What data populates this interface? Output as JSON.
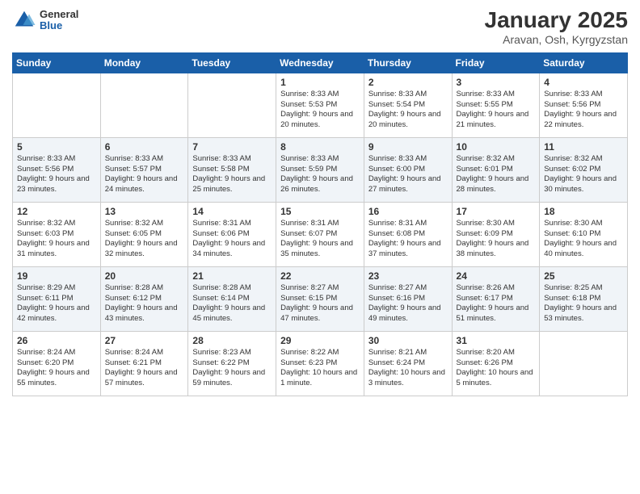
{
  "header": {
    "logo_general": "General",
    "logo_blue": "Blue",
    "month_title": "January 2025",
    "location": "Aravan, Osh, Kyrgyzstan"
  },
  "weekdays": [
    "Sunday",
    "Monday",
    "Tuesday",
    "Wednesday",
    "Thursday",
    "Friday",
    "Saturday"
  ],
  "weeks": [
    [
      {
        "day": "",
        "sunrise": "",
        "sunset": "",
        "daylight": ""
      },
      {
        "day": "",
        "sunrise": "",
        "sunset": "",
        "daylight": ""
      },
      {
        "day": "",
        "sunrise": "",
        "sunset": "",
        "daylight": ""
      },
      {
        "day": "1",
        "sunrise": "Sunrise: 8:33 AM",
        "sunset": "Sunset: 5:53 PM",
        "daylight": "Daylight: 9 hours and 20 minutes."
      },
      {
        "day": "2",
        "sunrise": "Sunrise: 8:33 AM",
        "sunset": "Sunset: 5:54 PM",
        "daylight": "Daylight: 9 hours and 20 minutes."
      },
      {
        "day": "3",
        "sunrise": "Sunrise: 8:33 AM",
        "sunset": "Sunset: 5:55 PM",
        "daylight": "Daylight: 9 hours and 21 minutes."
      },
      {
        "day": "4",
        "sunrise": "Sunrise: 8:33 AM",
        "sunset": "Sunset: 5:56 PM",
        "daylight": "Daylight: 9 hours and 22 minutes."
      }
    ],
    [
      {
        "day": "5",
        "sunrise": "Sunrise: 8:33 AM",
        "sunset": "Sunset: 5:56 PM",
        "daylight": "Daylight: 9 hours and 23 minutes."
      },
      {
        "day": "6",
        "sunrise": "Sunrise: 8:33 AM",
        "sunset": "Sunset: 5:57 PM",
        "daylight": "Daylight: 9 hours and 24 minutes."
      },
      {
        "day": "7",
        "sunrise": "Sunrise: 8:33 AM",
        "sunset": "Sunset: 5:58 PM",
        "daylight": "Daylight: 9 hours and 25 minutes."
      },
      {
        "day": "8",
        "sunrise": "Sunrise: 8:33 AM",
        "sunset": "Sunset: 5:59 PM",
        "daylight": "Daylight: 9 hours and 26 minutes."
      },
      {
        "day": "9",
        "sunrise": "Sunrise: 8:33 AM",
        "sunset": "Sunset: 6:00 PM",
        "daylight": "Daylight: 9 hours and 27 minutes."
      },
      {
        "day": "10",
        "sunrise": "Sunrise: 8:32 AM",
        "sunset": "Sunset: 6:01 PM",
        "daylight": "Daylight: 9 hours and 28 minutes."
      },
      {
        "day": "11",
        "sunrise": "Sunrise: 8:32 AM",
        "sunset": "Sunset: 6:02 PM",
        "daylight": "Daylight: 9 hours and 30 minutes."
      }
    ],
    [
      {
        "day": "12",
        "sunrise": "Sunrise: 8:32 AM",
        "sunset": "Sunset: 6:03 PM",
        "daylight": "Daylight: 9 hours and 31 minutes."
      },
      {
        "day": "13",
        "sunrise": "Sunrise: 8:32 AM",
        "sunset": "Sunset: 6:05 PM",
        "daylight": "Daylight: 9 hours and 32 minutes."
      },
      {
        "day": "14",
        "sunrise": "Sunrise: 8:31 AM",
        "sunset": "Sunset: 6:06 PM",
        "daylight": "Daylight: 9 hours and 34 minutes."
      },
      {
        "day": "15",
        "sunrise": "Sunrise: 8:31 AM",
        "sunset": "Sunset: 6:07 PM",
        "daylight": "Daylight: 9 hours and 35 minutes."
      },
      {
        "day": "16",
        "sunrise": "Sunrise: 8:31 AM",
        "sunset": "Sunset: 6:08 PM",
        "daylight": "Daylight: 9 hours and 37 minutes."
      },
      {
        "day": "17",
        "sunrise": "Sunrise: 8:30 AM",
        "sunset": "Sunset: 6:09 PM",
        "daylight": "Daylight: 9 hours and 38 minutes."
      },
      {
        "day": "18",
        "sunrise": "Sunrise: 8:30 AM",
        "sunset": "Sunset: 6:10 PM",
        "daylight": "Daylight: 9 hours and 40 minutes."
      }
    ],
    [
      {
        "day": "19",
        "sunrise": "Sunrise: 8:29 AM",
        "sunset": "Sunset: 6:11 PM",
        "daylight": "Daylight: 9 hours and 42 minutes."
      },
      {
        "day": "20",
        "sunrise": "Sunrise: 8:28 AM",
        "sunset": "Sunset: 6:12 PM",
        "daylight": "Daylight: 9 hours and 43 minutes."
      },
      {
        "day": "21",
        "sunrise": "Sunrise: 8:28 AM",
        "sunset": "Sunset: 6:14 PM",
        "daylight": "Daylight: 9 hours and 45 minutes."
      },
      {
        "day": "22",
        "sunrise": "Sunrise: 8:27 AM",
        "sunset": "Sunset: 6:15 PM",
        "daylight": "Daylight: 9 hours and 47 minutes."
      },
      {
        "day": "23",
        "sunrise": "Sunrise: 8:27 AM",
        "sunset": "Sunset: 6:16 PM",
        "daylight": "Daylight: 9 hours and 49 minutes."
      },
      {
        "day": "24",
        "sunrise": "Sunrise: 8:26 AM",
        "sunset": "Sunset: 6:17 PM",
        "daylight": "Daylight: 9 hours and 51 minutes."
      },
      {
        "day": "25",
        "sunrise": "Sunrise: 8:25 AM",
        "sunset": "Sunset: 6:18 PM",
        "daylight": "Daylight: 9 hours and 53 minutes."
      }
    ],
    [
      {
        "day": "26",
        "sunrise": "Sunrise: 8:24 AM",
        "sunset": "Sunset: 6:20 PM",
        "daylight": "Daylight: 9 hours and 55 minutes."
      },
      {
        "day": "27",
        "sunrise": "Sunrise: 8:24 AM",
        "sunset": "Sunset: 6:21 PM",
        "daylight": "Daylight: 9 hours and 57 minutes."
      },
      {
        "day": "28",
        "sunrise": "Sunrise: 8:23 AM",
        "sunset": "Sunset: 6:22 PM",
        "daylight": "Daylight: 9 hours and 59 minutes."
      },
      {
        "day": "29",
        "sunrise": "Sunrise: 8:22 AM",
        "sunset": "Sunset: 6:23 PM",
        "daylight": "Daylight: 10 hours and 1 minute."
      },
      {
        "day": "30",
        "sunrise": "Sunrise: 8:21 AM",
        "sunset": "Sunset: 6:24 PM",
        "daylight": "Daylight: 10 hours and 3 minutes."
      },
      {
        "day": "31",
        "sunrise": "Sunrise: 8:20 AM",
        "sunset": "Sunset: 6:26 PM",
        "daylight": "Daylight: 10 hours and 5 minutes."
      },
      {
        "day": "",
        "sunrise": "",
        "sunset": "",
        "daylight": ""
      }
    ]
  ]
}
